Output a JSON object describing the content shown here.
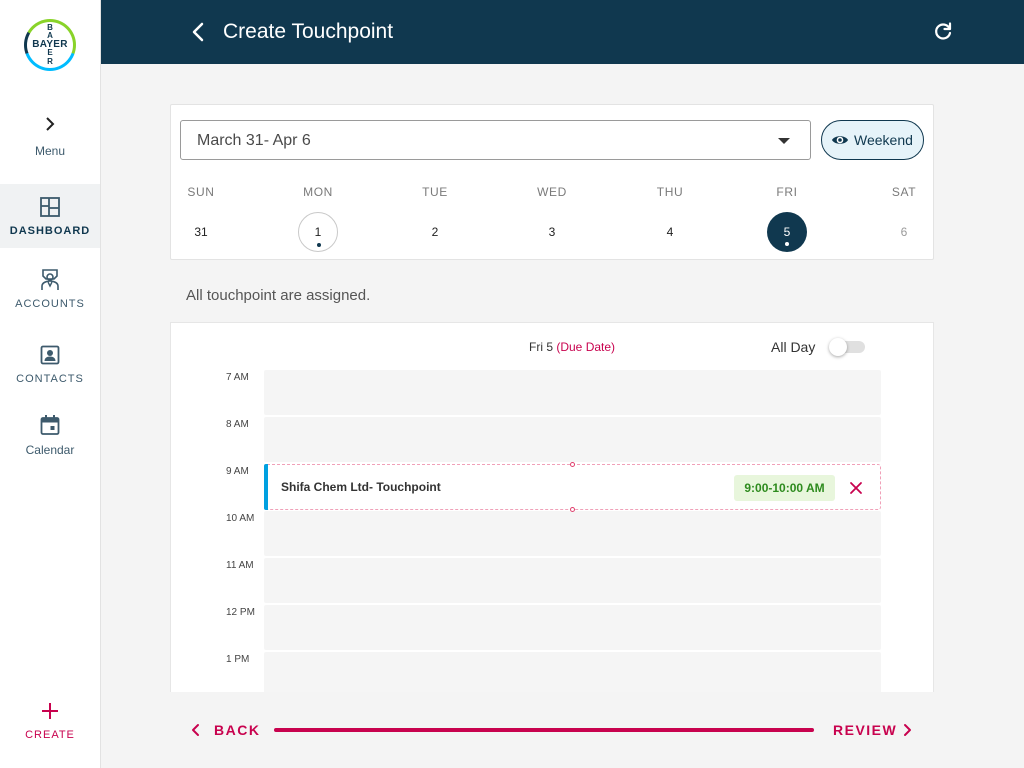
{
  "brand": {
    "logo_h": "BAYER",
    "logo_v": [
      "B",
      "A",
      "Y",
      "E",
      "R"
    ]
  },
  "sidebar": {
    "menu_label": "Menu",
    "items": [
      {
        "label": "DASHBOARD",
        "icon": "dashboard-icon",
        "active": true
      },
      {
        "label": "ACCOUNTS",
        "icon": "accounts-icon"
      },
      {
        "label": "CONTACTS",
        "icon": "contacts-icon"
      },
      {
        "label": "Calendar",
        "icon": "calendar-icon"
      }
    ],
    "create_label": "CREATE"
  },
  "header": {
    "title": "Create Touchpoint",
    "back_icon": "chevron-left-icon",
    "refresh_icon": "refresh-icon"
  },
  "week": {
    "range": "March 31- Apr 6",
    "weekend_label": "Weekend",
    "days": [
      {
        "name": "SUN",
        "num": "31"
      },
      {
        "name": "MON",
        "num": "1"
      },
      {
        "name": "TUE",
        "num": "2"
      },
      {
        "name": "WED",
        "num": "3"
      },
      {
        "name": "THU",
        "num": "4"
      },
      {
        "name": "FRI",
        "num": "5"
      },
      {
        "name": "SAT",
        "num": "6"
      }
    ]
  },
  "status": "All touchpoint are assigned.",
  "schedule": {
    "date_label": "Fri 5",
    "due_label": "(Due Date)",
    "all_day_label": "All Day",
    "all_day": false,
    "hours": [
      "7 AM",
      "8 AM",
      "9 AM",
      "10 AM",
      "11 AM",
      "12 PM",
      "1 PM"
    ],
    "event": {
      "name": "Shifa Chem Ltd- Touchpoint",
      "time": "9:00-10:00 AM"
    }
  },
  "footer": {
    "back_label": "BACK",
    "review_label": "REVIEW"
  },
  "colors": {
    "primary": "#10384f",
    "accent": "#c8024e",
    "event_bar": "#00a0e0",
    "time_green": "#2e8b1e"
  }
}
